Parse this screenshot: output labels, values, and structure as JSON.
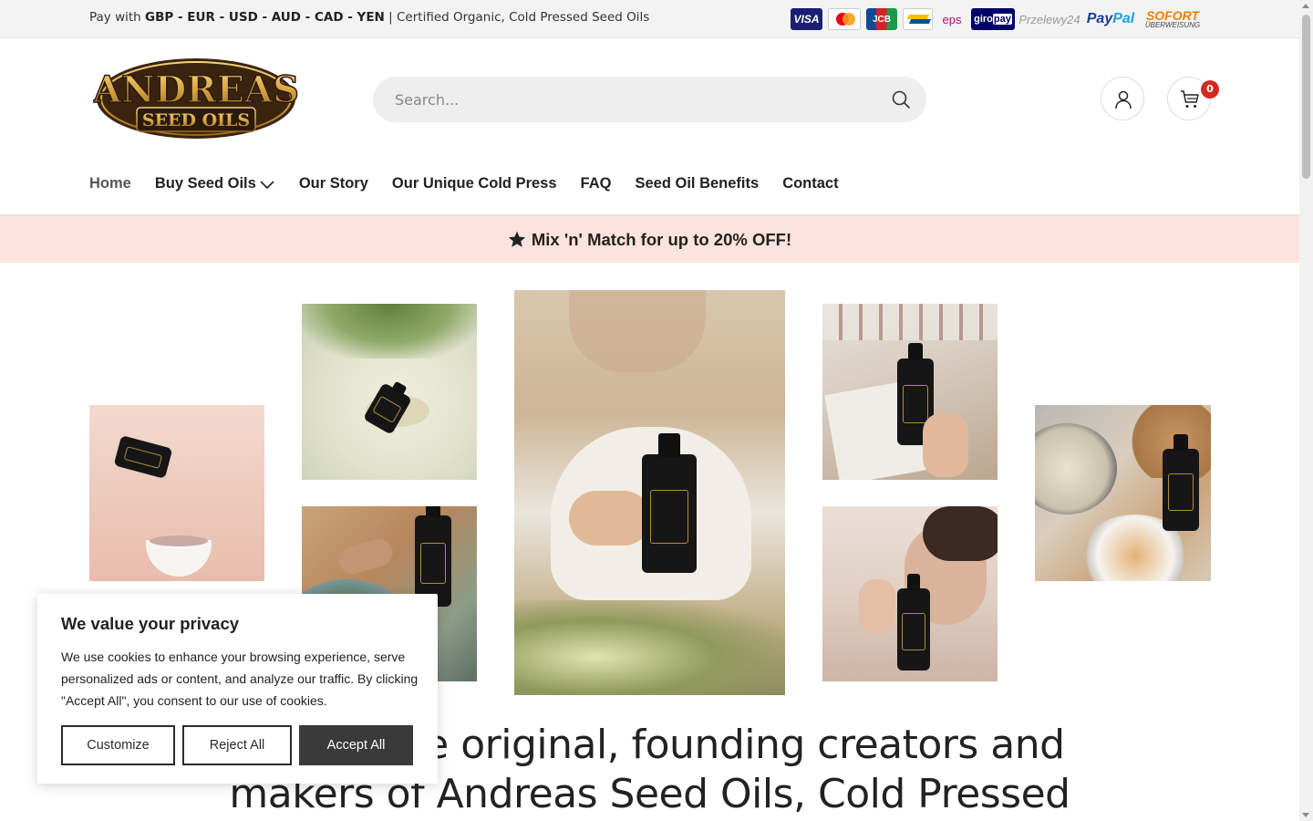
{
  "topbar": {
    "pay_prefix": "Pay with",
    "currencies": "GBP - EUR - USD - AUD - CAD - YEN",
    "separator": "|",
    "tagline": "Certified Organic, Cold Pressed Seed Oils",
    "payment_methods": [
      "VISA",
      "Mastercard",
      "JCB",
      "Bancontact",
      "eps",
      "giropay",
      "Przelewy24",
      "PayPal",
      "SOFORT ÜBERWEISUNG"
    ]
  },
  "header": {
    "logo_line1": "ANDREAS",
    "logo_line2": "SEED OILS",
    "search_placeholder": "Search...",
    "cart_count": "0"
  },
  "nav": {
    "items": [
      "Home",
      "Buy Seed Oils",
      "Our Story",
      "Our Unique Cold Press",
      "FAQ",
      "Seed Oil Benefits",
      "Contact"
    ]
  },
  "promo": {
    "text": "Mix 'n' Match for up to 20% OFF!"
  },
  "hero": {
    "headline": "We are the original, founding creators and makers of Andreas Seed Oils, Cold Pressed"
  },
  "cookie": {
    "title": "We value your privacy",
    "body": "We use cookies to enhance your browsing experience, serve personalized ads or content, and analyze our traffic. By clicking \"Accept All\", you consent to our use of cookies.",
    "customize": "Customize",
    "reject": "Reject All",
    "accept": "Accept All"
  },
  "colors": {
    "promo_bg": "#fde3dd",
    "cart_badge": "#d12a20",
    "accept_button": "#3a3a3a",
    "logo_gold": "#d9a441",
    "logo_dark": "#2a1a0c"
  }
}
